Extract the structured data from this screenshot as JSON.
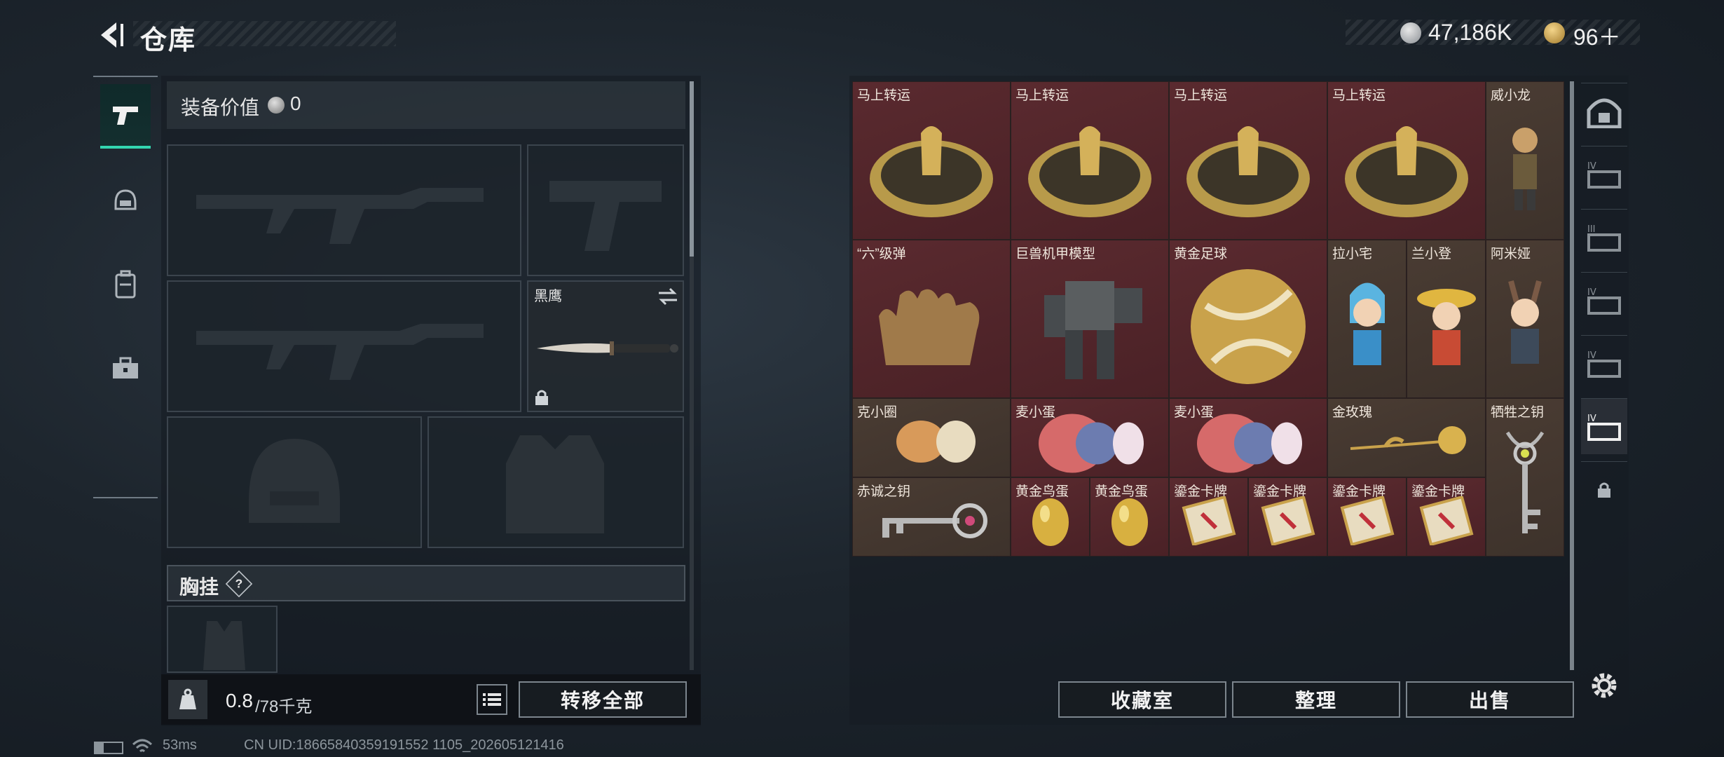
{
  "header": {
    "title": "仓库"
  },
  "currency": {
    "coins": "47,186K",
    "coupons": "96＋"
  },
  "equipment": {
    "value_label": "装备价值",
    "value": "0",
    "melee_label": "黑鹰",
    "chest_label": "胸挂",
    "help_label": "?"
  },
  "capacity": {
    "current": "0.8",
    "max": "/78千克"
  },
  "buttons": {
    "transfer_all": "转移全部",
    "collection": "收藏室",
    "organize": "整理",
    "sell": "出售"
  },
  "stash_items": [
    {
      "name": "马上转运",
      "bg": "red"
    },
    {
      "name": "马上转运",
      "bg": "red"
    },
    {
      "name": "马上转运",
      "bg": "red"
    },
    {
      "name": "马上转运",
      "bg": "red"
    },
    {
      "name": "威小龙",
      "bg": "brown"
    },
    {
      "name": "“六”级弹",
      "bg": "red"
    },
    {
      "name": "巨兽机甲模型",
      "bg": "red"
    },
    {
      "name": "黄金足球",
      "bg": "red"
    },
    {
      "name": "拉小宅",
      "bg": "brown"
    },
    {
      "name": "兰小登",
      "bg": "brown"
    },
    {
      "name": "阿米娅",
      "bg": "brown"
    },
    {
      "name": "克小圈",
      "bg": "brown"
    },
    {
      "name": "麦小蛋",
      "bg": "red"
    },
    {
      "name": "麦小蛋",
      "bg": "red"
    },
    {
      "name": "金玫瑰",
      "bg": "brown"
    },
    {
      "name": "牺牲之钥",
      "bg": "brown"
    },
    {
      "name": "赤诚之钥",
      "bg": "brown"
    },
    {
      "name": "黄金鸟蛋",
      "bg": "red"
    },
    {
      "name": "黄金鸟蛋",
      "bg": "red"
    },
    {
      "name": "鎏金卡牌",
      "bg": "red"
    },
    {
      "name": "鎏金卡牌",
      "bg": "red"
    },
    {
      "name": "鎏金卡牌",
      "bg": "red"
    },
    {
      "name": "鎏金卡牌",
      "bg": "red"
    }
  ],
  "status_bar": {
    "ping": "53ms",
    "uid": "CN UID:18665840359191552 1105_202605121416"
  },
  "colors": {
    "accent": "#33d6b0",
    "rare_red": "#5a2a2f",
    "uncommon_brown": "#4a3c33"
  },
  "icons": [
    "back-arrow-icon",
    "pistol-icon",
    "helmet-icon",
    "backpack-icon",
    "toolbox-icon",
    "weight-icon",
    "list-icon",
    "settings-icon",
    "lock-icon",
    "swap-icon"
  ]
}
